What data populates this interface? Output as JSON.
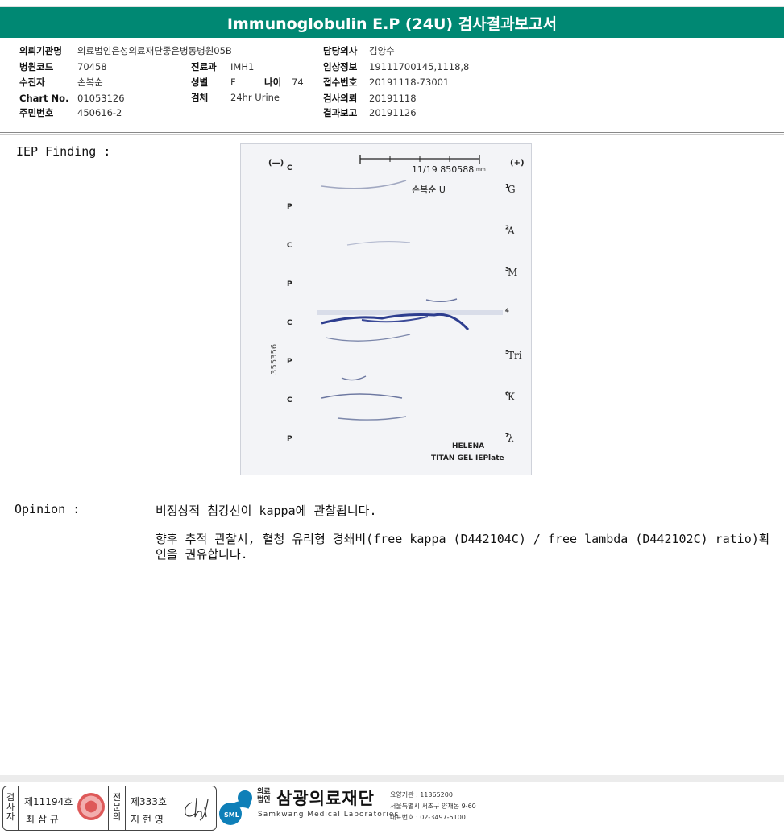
{
  "header": {
    "title": "Immunoglobulin E.P (24U) 검사결과보고서"
  },
  "patient_info": {
    "institution_label": "의뢰기관명",
    "institution": "의료법인은성의료재단좋은병동병원05B",
    "hospital_code_label": "병원코드",
    "hospital_code": "70458",
    "patient_label": "수진자",
    "patient": "손복순",
    "chart_label": "Chart No.",
    "chart": "01053126",
    "resident_label": "주민번호",
    "resident": "450616-2",
    "dept_label": "진료과",
    "dept": "IMH1",
    "sex_label": "성별",
    "sex": "F",
    "age_label": "나이",
    "age": "74",
    "specimen_label": "검체",
    "specimen": "24hr Urine",
    "doctor_label": "담당의사",
    "doctor": "김양수",
    "clinical_label": "임상정보",
    "clinical": "19111700145,1118,8",
    "receipt_label": "접수번호",
    "receipt": "20191118-73001",
    "request_label": "검사의뢰",
    "request": "20191118",
    "report_label": "결과보고",
    "report": "20191126"
  },
  "iep": {
    "label": "IEP Finding :",
    "gel": {
      "minus": "(—)",
      "plus": "(+)",
      "sample_id": "11/19 850588",
      "scale_unit": "mm",
      "patient_tag": "손복순 U",
      "side_code": "355356",
      "lanes": [
        "C",
        "P",
        "C",
        "P",
        "C",
        "P",
        "C",
        "P"
      ],
      "antisera": [
        {
          "num": "1",
          "name": "G"
        },
        {
          "num": "2",
          "name": "A"
        },
        {
          "num": "3",
          "name": "M"
        },
        {
          "num": "4",
          "name": ""
        },
        {
          "num": "5",
          "name": "Tri"
        },
        {
          "num": "6",
          "name": "K"
        },
        {
          "num": "7",
          "name": "λ"
        }
      ],
      "brand1": "HELENA",
      "brand2": "TITAN GEL IEPlate"
    }
  },
  "opinion": {
    "label": "Opinion :",
    "line1": "비정상적 침강선이 kappa에 관찰됩니다.",
    "line2": "향후 추적 관찰시, 혈청 유리형 경쇄비(free kappa (D442104C) / free lambda (D442102C) ratio)확인을 권유합니다."
  },
  "footer": {
    "inspector_vertical": "검사자",
    "inspector_no": "제11194호",
    "inspector_name": "최 삼 규",
    "specialist_vertical": "전문의",
    "specialist_no": "제333호",
    "specialist_name": "지 현 영",
    "logo_badge": "SML",
    "org_type": "의료법인",
    "org_name": "삼광의료재단",
    "org_en": "Samkwang Medical Laboratories",
    "org_code": "요양기관 : 11365200",
    "org_address": "서울특별시 서초구 양재동 9-60",
    "org_phone": "대표번호 : 02-3497-5100",
    "brand_color": "#008873"
  }
}
